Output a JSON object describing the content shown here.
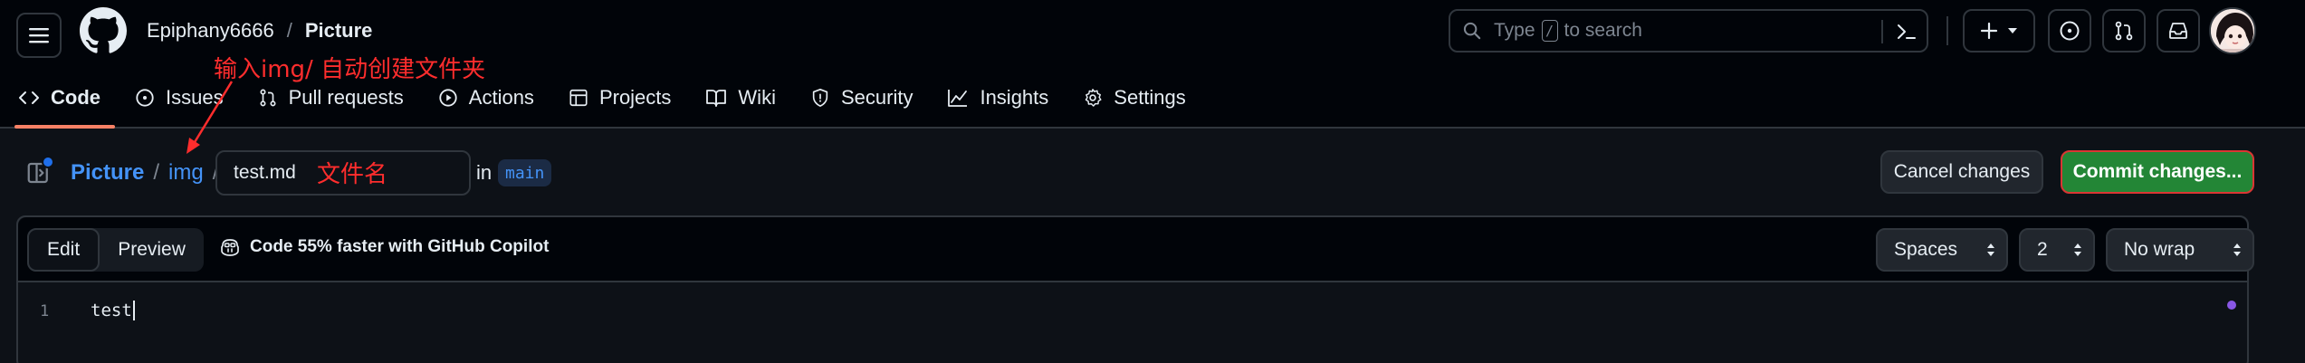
{
  "header": {
    "owner": "Epiphany6666",
    "separator": "/",
    "repo": "Picture",
    "search": {
      "placeholder_before": "Type",
      "shortcut_key": "/",
      "placeholder_after": "to search"
    }
  },
  "repo_nav": {
    "items": [
      {
        "label": "Code",
        "icon": "code-icon",
        "active": true
      },
      {
        "label": "Issues",
        "icon": "issue-opened-icon"
      },
      {
        "label": "Pull requests",
        "icon": "git-pull-request-icon"
      },
      {
        "label": "Actions",
        "icon": "play-icon"
      },
      {
        "label": "Projects",
        "icon": "table-icon"
      },
      {
        "label": "Wiki",
        "icon": "book-icon"
      },
      {
        "label": "Security",
        "icon": "shield-icon"
      },
      {
        "label": "Insights",
        "icon": "graph-icon"
      },
      {
        "label": "Settings",
        "icon": "gear-icon"
      }
    ]
  },
  "editor_header": {
    "path": {
      "repo_link": "Picture",
      "sep1": "/",
      "folder_link": "img",
      "sep2": "/"
    },
    "filename_value": "test.md",
    "in_label": "in",
    "branch": "main",
    "cancel_label": "Cancel changes",
    "commit_label": "Commit changes..."
  },
  "editor": {
    "tabs": [
      {
        "label": "Edit",
        "active": true
      },
      {
        "label": "Preview",
        "active": false
      }
    ],
    "copilot_label": "Code 55% faster with GitHub Copilot",
    "indent_mode": "Spaces",
    "indent_size": "2",
    "wrap_mode": "No wrap",
    "lines": [
      {
        "number": "1",
        "text": "test"
      }
    ]
  },
  "annotations": {
    "top_note": "输入img/ 自动创建文件夹",
    "filename_note": "文件名"
  },
  "colors": {
    "accent_blue": "#4493f8",
    "commit_green": "#238636",
    "active_underline": "#f78166",
    "annotation_red": "#ff2d2d"
  }
}
